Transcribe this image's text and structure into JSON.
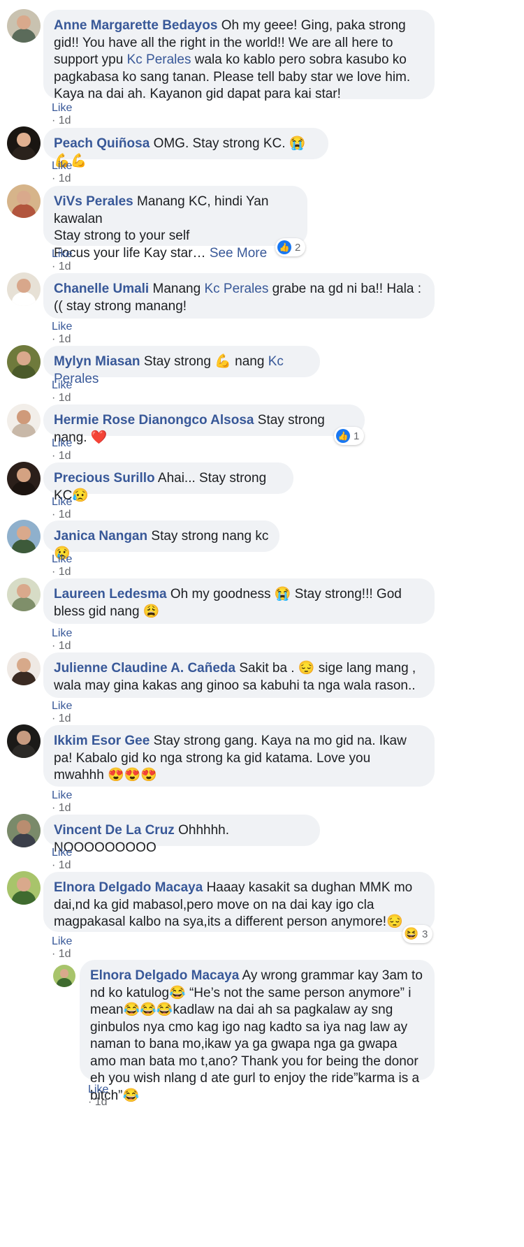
{
  "actions": {
    "like": "Like",
    "sep": " · ",
    "time": "1d"
  },
  "comments": [
    {
      "name": "Anne Margarette Bedayos",
      "parts": [
        "Oh my geee! Ging, paka strong gid!! You have all the right in the world!! We are all here to support ypu ",
        "Kc Perales",
        " wala ko kablo pero sobra kasubo ko pagkabasa ko sang tanan. Please tell baby star we love him. Kaya na dai ah. Kayanon gid dapat para kai star!"
      ]
    },
    {
      "name": "Peach Quiñosa",
      "text": "OMG. Stay strong KC. 😭💪💪"
    },
    {
      "name": "ViVs Perales",
      "lines": [
        "Manang KC, hindi Yan kawalan",
        "Stay strong to your self",
        "Focus your life Kay star…"
      ],
      "see_more": "See More",
      "reaction_count": "2"
    },
    {
      "name": "Chanelle Umali",
      "parts": [
        "Manang ",
        "Kc Perales",
        " grabe na gd ni ba!! Hala :(( stay strong manang!"
      ]
    },
    {
      "name": "Mylyn Miasan",
      "parts": [
        "Stay strong 💪 nang ",
        "Kc Perales"
      ]
    },
    {
      "name": "Hermie Rose Dianongco Alsosa",
      "text": "Stay strong nang. ❤️",
      "reaction_count": "1"
    },
    {
      "name": "Precious Surillo",
      "text": "Ahai... Stay strong KC😥"
    },
    {
      "name": "Janica Nangan",
      "text": "Stay strong nang kc 😢"
    },
    {
      "name": "Laureen Ledesma",
      "text": "Oh my goodness 😭 Stay strong!!! God bless gid nang 😩"
    },
    {
      "name": "Julienne Claudine A. Cañeda",
      "text": "Sakit ba . 😔 sige lang mang , wala may gina kakas ang ginoo sa kabuhi ta nga wala rason.."
    },
    {
      "name": "Ikkim Esor Gee",
      "text": "Stay strong gang. Kaya na mo gid na. Ikaw pa! Kabalo gid ko nga strong ka gid katama. Love you mwahhh 😍😍😍"
    },
    {
      "name": "Vincent De La Cruz",
      "text": "Ohhhhh. NOOOOOOOOO"
    },
    {
      "name": "Elnora Delgado Macaya",
      "text": "Haaay kasakit sa dughan MMK mo dai,nd ka gid mabasol,pero move on na dai kay igo cla magpakasal kalbo na sya,its a different person anymore!😔",
      "reaction_count": "3"
    },
    {
      "name": "Elnora Delgado Macaya",
      "text": "Ay wrong grammar kay 3am to nd ko katulog😂 “He’s not the same person anymore” i mean😂😂😂kadlaw na dai ah sa pagkalaw ay sng ginbulos nya cmo kag igo nag kadto sa iya nag law ay naman to bana mo,ikaw ya ga gwapa nga ga gwapa amo man bata mo t,ano? Thank you for being the donor eh you wish nlang d ate gurl to enjoy the ride”karma is a bitch”😂"
    }
  ]
}
